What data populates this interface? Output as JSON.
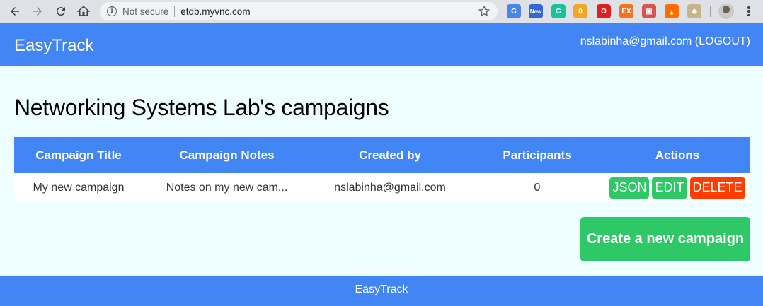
{
  "browser": {
    "security_label": "Not secure",
    "url": "etdb.myvnc.com",
    "extensions": [
      {
        "name": "translate-ext-icon",
        "color": "#4a86e8",
        "glyph": "G"
      },
      {
        "name": "new-ext-icon",
        "color": "#3367d6",
        "glyph": "New"
      },
      {
        "name": "grammarly-ext-icon",
        "color": "#15c39a",
        "glyph": "G"
      },
      {
        "name": "brave-ext-icon",
        "color": "#f5a623",
        "glyph": "0"
      },
      {
        "name": "adblock-ext-icon",
        "color": "#e02020",
        "glyph": "O"
      },
      {
        "name": "ex-ext-icon",
        "color": "#f47321",
        "glyph": "EX"
      },
      {
        "name": "window-ext-icon",
        "color": "#d9534f",
        "glyph": "▣"
      },
      {
        "name": "flame-ext-icon",
        "color": "#ff6d00",
        "glyph": "🔥"
      },
      {
        "name": "diamond-ext-icon",
        "color": "#c7b48a",
        "glyph": "◆"
      }
    ]
  },
  "header": {
    "brand": "EasyTrack",
    "user_label": "nslabinha@gmail.com (LOGOUT)"
  },
  "page": {
    "title": "Networking Systems Lab's campaigns"
  },
  "table": {
    "columns": [
      "Campaign Title",
      "Campaign Notes",
      "Created by",
      "Participants",
      "Actions"
    ],
    "rows": [
      {
        "title": "My new campaign",
        "notes": "Notes on my new cam...",
        "created_by": "nslabinha@gmail.com",
        "participants": "0",
        "actions": {
          "json": "JSON",
          "edit": "EDIT",
          "delete": "DELETE"
        }
      }
    ]
  },
  "create_button": "Create a new campaign",
  "footer": "EasyTrack",
  "colors": {
    "primary": "#4285f4",
    "success": "#2ec866",
    "danger": "#ff3d00",
    "background": "#efffff"
  }
}
